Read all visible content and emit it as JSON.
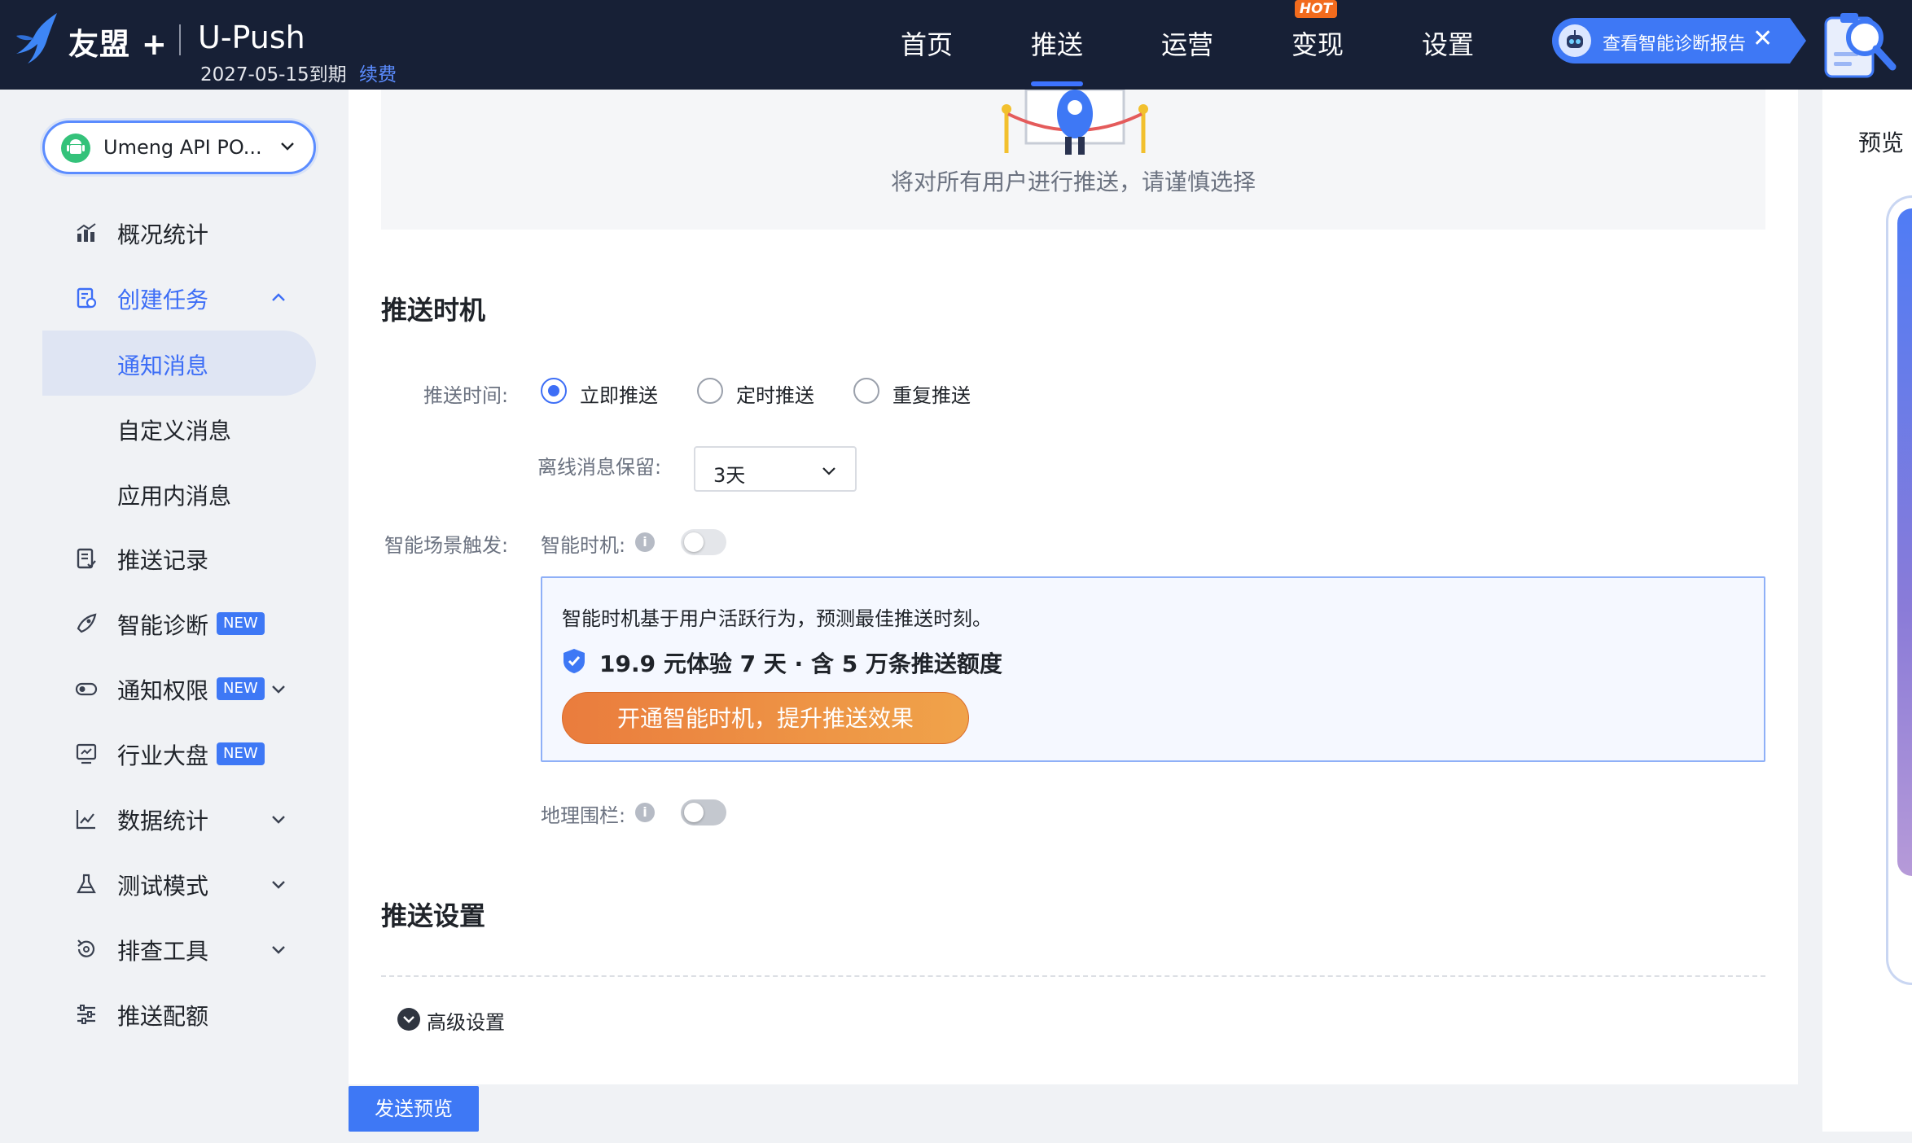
{
  "topbar": {
    "brand": "友盟 +",
    "product": "U-Push",
    "expire_text": "2027-05-15到期",
    "renew_label": "续费",
    "nav": [
      {
        "label": "首页",
        "active": false
      },
      {
        "label": "推送",
        "active": true
      },
      {
        "label": "运营",
        "active": false
      },
      {
        "label": "变现",
        "active": false,
        "badge": "HOT"
      },
      {
        "label": "设置",
        "active": false
      }
    ],
    "diagnosis_label": "查看智能诊断报告",
    "close_glyph": "✕"
  },
  "sidebar": {
    "app_selector": "Umeng API PO...",
    "menu": {
      "overview": "概况统计",
      "create_task": "创建任务",
      "notification": "通知消息",
      "custom_message": "自定义消息",
      "in_app_message": "应用内消息",
      "push_records": "推送记录",
      "smart_diagnosis": "智能诊断",
      "notify_permission": "通知权限",
      "industry_board": "行业大盘",
      "data_stats": "数据统计",
      "test_mode": "测试模式",
      "troubleshoot": "排查工具",
      "push_quota": "推送配额"
    },
    "new_badge": "NEW"
  },
  "main": {
    "hero_text": "将对所有用户进行推送，请谨慎选择",
    "timing_section": "推送时机",
    "push_time_label": "推送时间:",
    "radios": [
      "立即推送",
      "定时推送",
      "重复推送"
    ],
    "radio_selected": 0,
    "offline_label": "离线消息保留:",
    "offline_value": "3天",
    "smart_trigger_label": "智能场景触发:",
    "smart_timing_label": "智能时机:",
    "smart_desc": "智能时机基于用户活跃行为，预测最佳推送时刻。",
    "smart_offer": "19.9 元体验 7 天 · 含 5 万条推送额度",
    "smart_button": "开通智能时机，提升推送效果",
    "geofence_label": "地理围栏:",
    "settings_section": "推送设置",
    "advanced_label": "高级设置",
    "info_glyph": "i"
  },
  "footer": {
    "send_preview": "发送预览"
  },
  "preview": {
    "title": "预览"
  },
  "colors": {
    "topbar_bg": "#172036",
    "primary": "#3e78f5",
    "active_text": "#3d6ef6",
    "hot": "#f26b1d",
    "cta_start": "#ea7c3d",
    "cta_end": "#f0a34a"
  }
}
